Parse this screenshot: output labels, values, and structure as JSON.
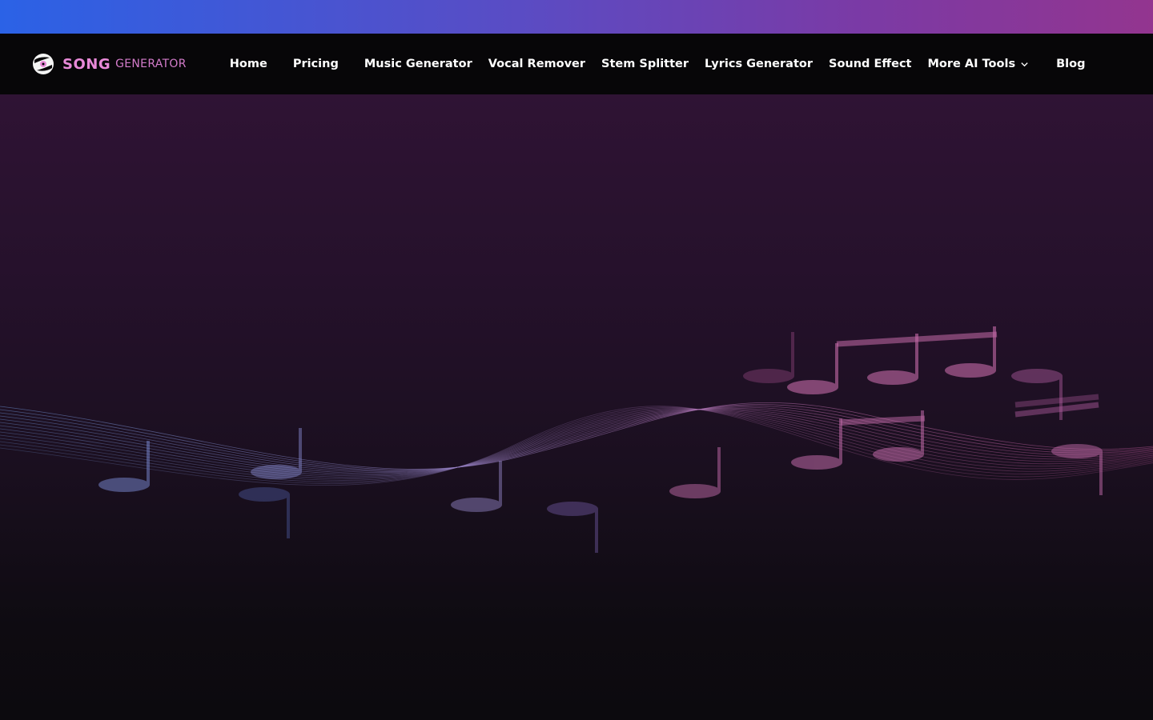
{
  "brand": {
    "name_primary": "SONG",
    "name_secondary": "GENERATOR",
    "logo_icon": "vinyl-disc-icon"
  },
  "nav": {
    "items": [
      {
        "label": "Home"
      },
      {
        "label": "Pricing"
      },
      {
        "label": "Music Generator"
      },
      {
        "label": "Vocal Remover"
      },
      {
        "label": "Stem Splitter"
      },
      {
        "label": "Lyrics Generator"
      },
      {
        "label": "Sound Effect"
      },
      {
        "label": "More AI Tools",
        "icon": "chevron-down-icon"
      },
      {
        "label": "Blog"
      }
    ]
  },
  "colors": {
    "brand_pink": "#e889d8",
    "nav_bg": "#070608",
    "gradient_start": "#2b62e6",
    "gradient_end": "#93358f"
  },
  "hero": {
    "illustration": "music-notes-wave"
  }
}
